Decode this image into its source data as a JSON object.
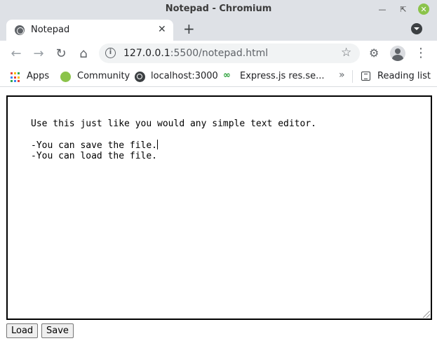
{
  "window": {
    "title": "Notepad - Chromium"
  },
  "tab": {
    "title": "Notepad",
    "close": "✕",
    "new_tab": "+"
  },
  "toolbar": {
    "url_host": "127.0.0.1",
    "url_rest": ":5500/notepad.html",
    "info": "i"
  },
  "bookmarks": {
    "items": [
      {
        "label": "Apps",
        "icon": "apps-grid-icon"
      },
      {
        "label": "Community",
        "icon": "linux-mint-icon"
      },
      {
        "label": "localhost:3000",
        "icon": "globe-icon"
      },
      {
        "label": "Express.js res.se...",
        "icon": "express-icon"
      }
    ],
    "more": "»",
    "reading_list": "Reading list"
  },
  "editor": {
    "line1": "Use this just like you would any simple text editor.",
    "line2": "-You can save the file.",
    "line3": "-You can load the file."
  },
  "buttons": {
    "load": "Load",
    "save": "Save"
  },
  "colors": {
    "apps_grid": [
      "#ea4335",
      "#fbbc04",
      "#34a853",
      "#4285f4"
    ],
    "community_accent": "#8bc34a",
    "express_accent": "#259e34"
  }
}
